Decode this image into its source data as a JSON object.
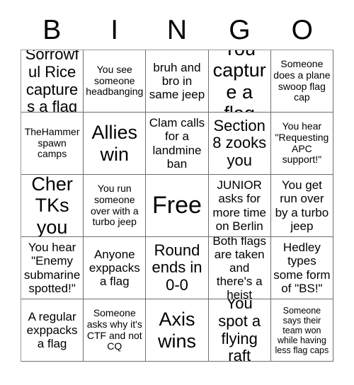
{
  "card": {
    "header_letters": [
      "B",
      "I",
      "N",
      "G",
      "O"
    ],
    "columns": 5,
    "rows": 5,
    "colors": {
      "background": "#ffffff",
      "text": "#000000",
      "grid_line": "#6e6e6e"
    },
    "cells": [
      {
        "text": "Sorrowful Rice captures a flag",
        "size": "l"
      },
      {
        "text": "You see someone headbanging",
        "size": "s"
      },
      {
        "text": "bruh and bro in same jeep",
        "size": "m"
      },
      {
        "text": "You capture a flag",
        "size": "xl"
      },
      {
        "text": "Someone does a plane swoop flag cap",
        "size": "s"
      },
      {
        "text": "TheHammer spawn camps",
        "size": "s"
      },
      {
        "text": "Allies win",
        "size": "xl"
      },
      {
        "text": "Clam calls for a landmine ban",
        "size": "m"
      },
      {
        "text": "Section 8 zooks you",
        "size": "l"
      },
      {
        "text": "You hear \"Requesting APC support!\"",
        "size": "s"
      },
      {
        "text": "Cher TKs you",
        "size": "xl"
      },
      {
        "text": "You run someone over with a turbo jeep",
        "size": "s"
      },
      {
        "text": "Free",
        "size": "xxl"
      },
      {
        "text": "JUNIOR asks for more time on Berlin",
        "size": "m"
      },
      {
        "text": "You get run over by a turbo jeep",
        "size": "m"
      },
      {
        "text": "You hear \"Enemy submarine spotted!\"",
        "size": "m"
      },
      {
        "text": "Anyone exppacks a flag",
        "size": "m"
      },
      {
        "text": "Round ends in 0-0",
        "size": "l"
      },
      {
        "text": "Both flags are taken and there's a heist",
        "size": "m"
      },
      {
        "text": "Hedley types some form of \"BS!\"",
        "size": "m"
      },
      {
        "text": "A regular exppacks a flag",
        "size": "m"
      },
      {
        "text": "Someone asks why it's CTF and not CQ",
        "size": "s"
      },
      {
        "text": "Axis wins",
        "size": "xl"
      },
      {
        "text": "You spot a flying raft",
        "size": "l"
      },
      {
        "text": "Someone says their team won while having less flag caps",
        "size": "xs"
      }
    ]
  }
}
